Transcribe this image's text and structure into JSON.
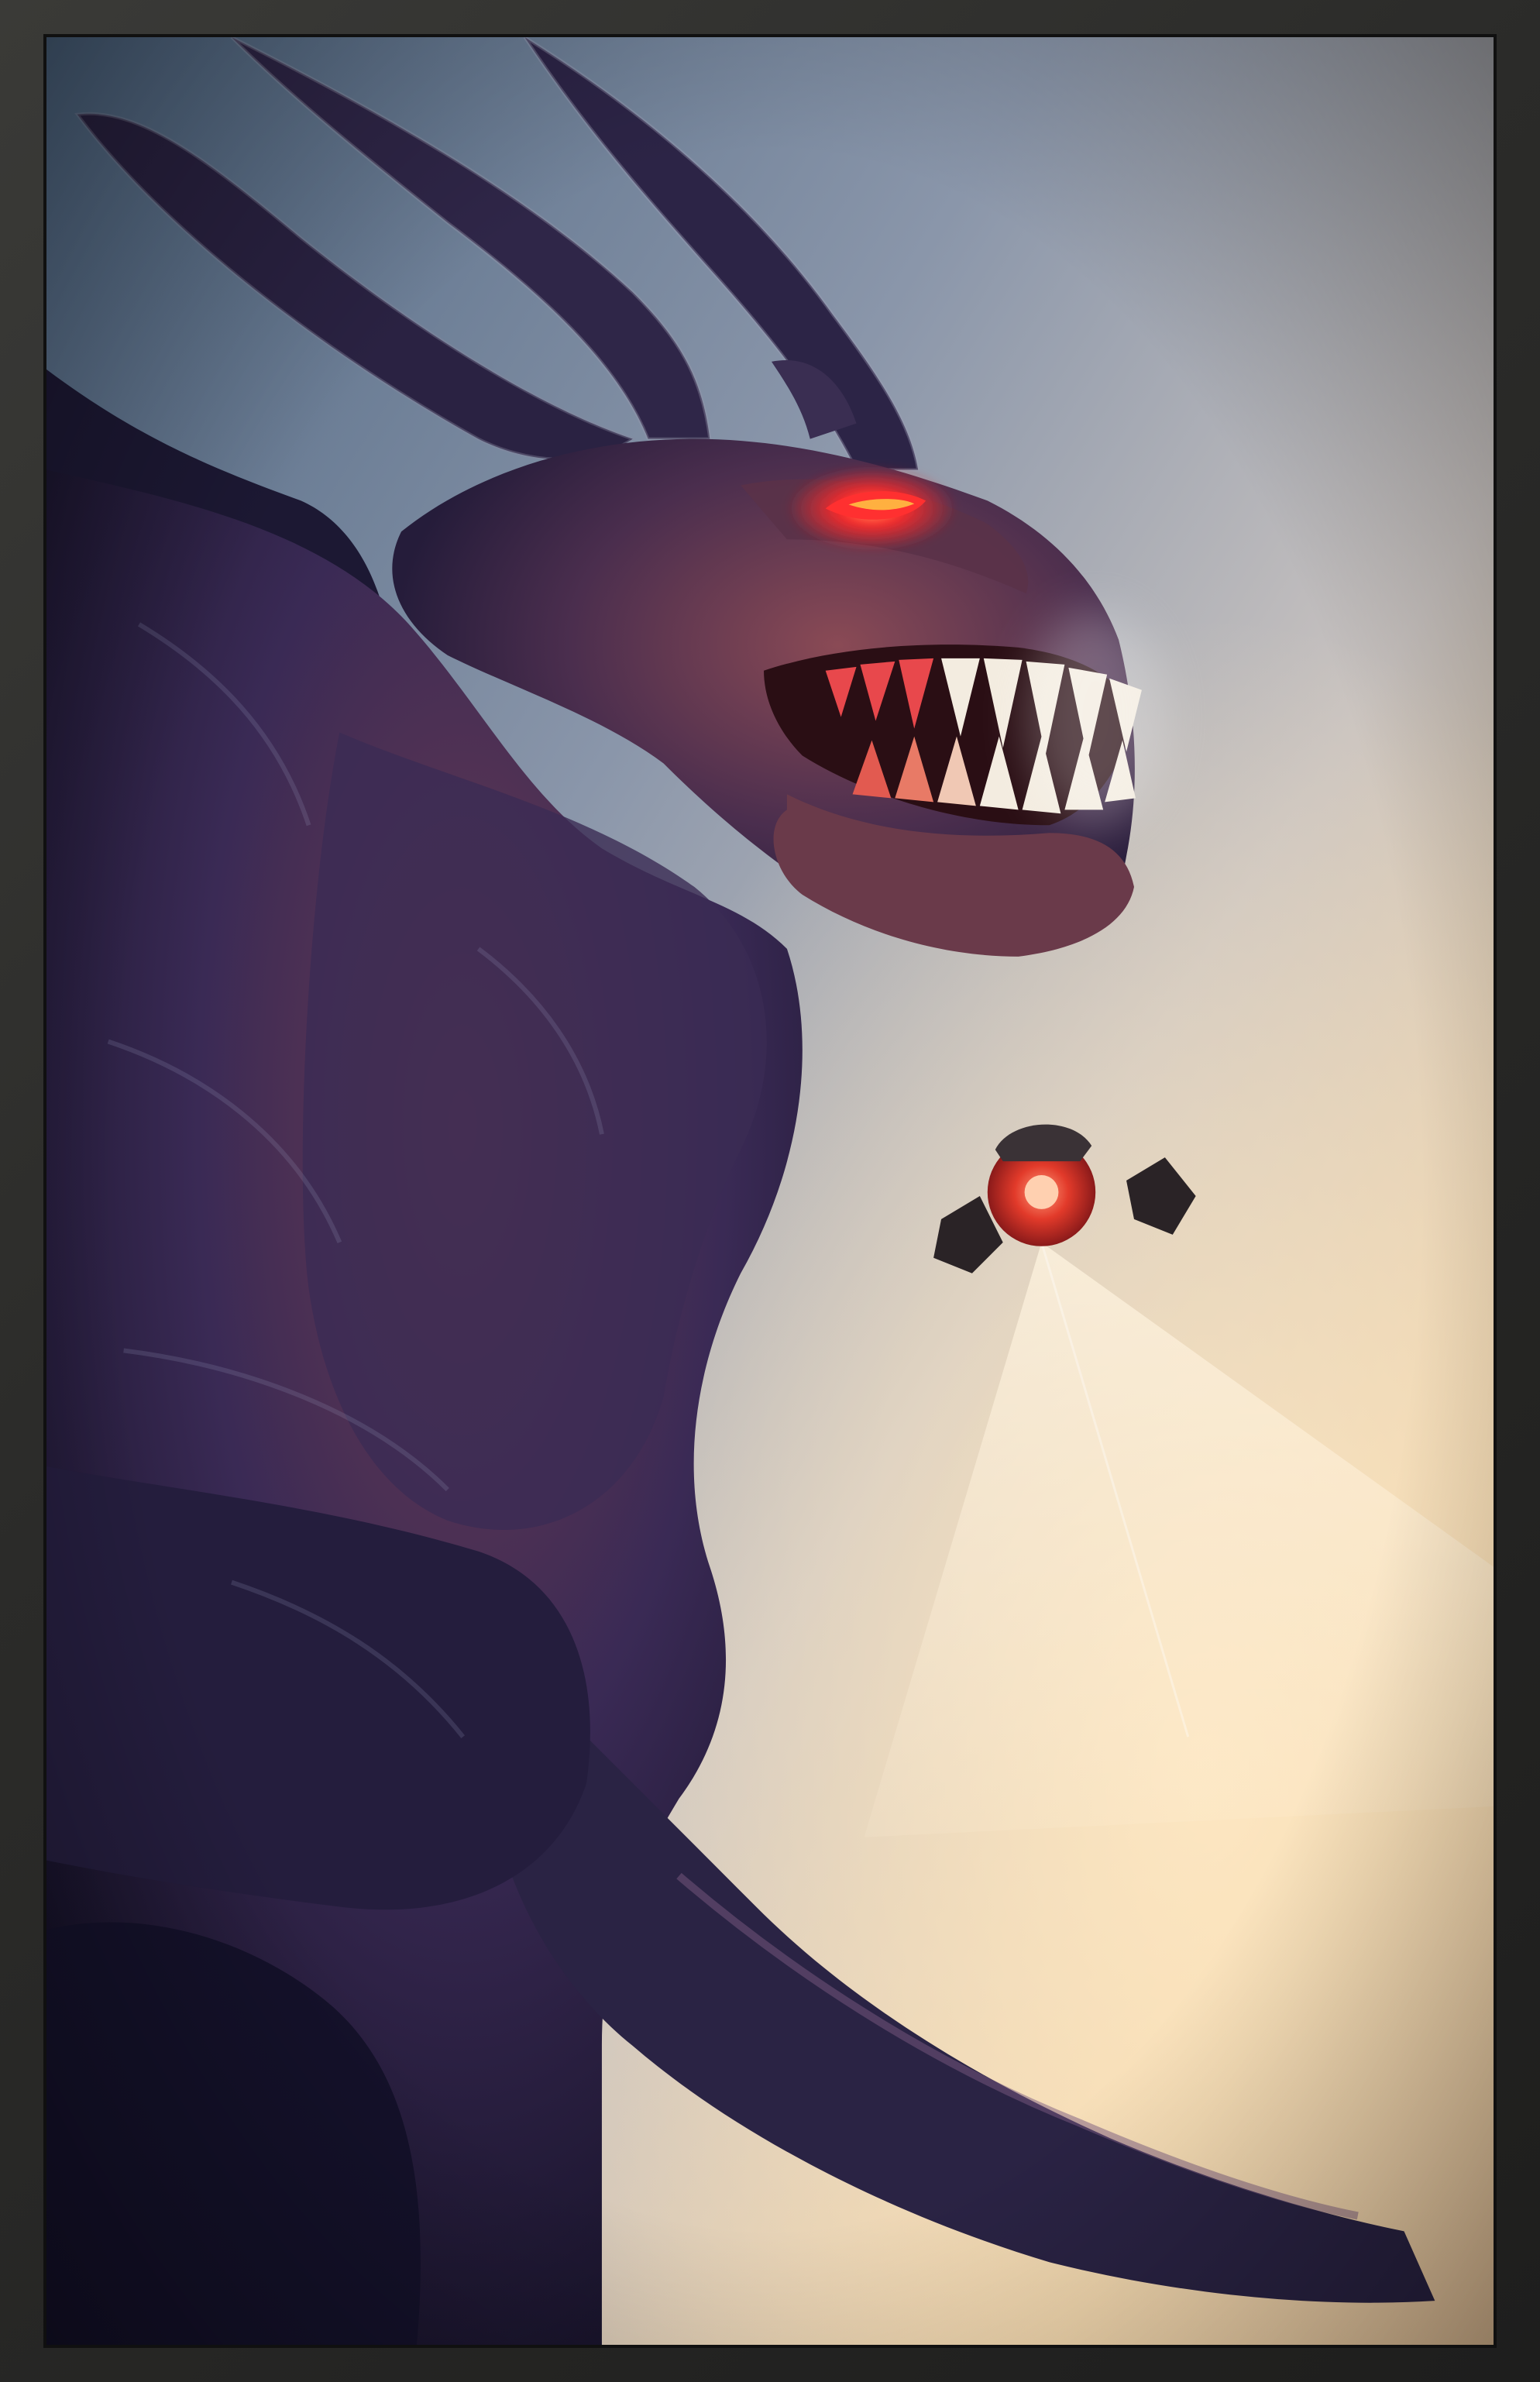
{
  "image": {
    "subject": "horned-creature",
    "secondary_subject": "hovering-drone",
    "colors": {
      "frame": "#2c2c2a",
      "frame_edge": "#101010",
      "sky_top": "#566f8c",
      "sky_mid": "#9aa3b4",
      "sky_warm": "#f1cf9f",
      "creature_skin": "#2a2346",
      "creature_flesh": "#6d3848",
      "eye_glow": "#ff2a2a",
      "teeth": "#f3ece0",
      "beam": "#fff0d8"
    }
  }
}
